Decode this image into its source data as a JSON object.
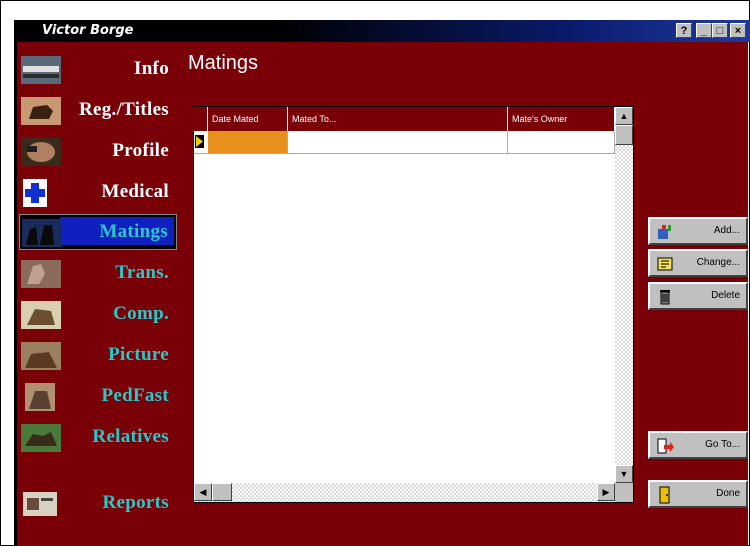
{
  "window": {
    "title": "Victor Borge"
  },
  "titlebar_buttons": {
    "help": "?",
    "minimize": "_",
    "maximize": "□",
    "close": "×"
  },
  "nav": [
    {
      "label": "Info",
      "icon": "info-icon",
      "color": "white"
    },
    {
      "label": "Reg./Titles",
      "icon": "horse-titles-icon",
      "color": "white"
    },
    {
      "label": "Profile",
      "icon": "profile-icon",
      "color": "white"
    },
    {
      "label": "Medical",
      "icon": "medical-cross-icon",
      "color": "white"
    },
    {
      "label": "Matings",
      "icon": "matings-icon",
      "color": "cyan",
      "active": true
    },
    {
      "label": "Trans.",
      "icon": "transfer-icon",
      "color": "cyan"
    },
    {
      "label": "Comp.",
      "icon": "competition-icon",
      "color": "cyan"
    },
    {
      "label": "Picture",
      "icon": "picture-icon",
      "color": "cyan"
    },
    {
      "label": "PedFast",
      "icon": "pedigree-icon",
      "color": "cyan"
    },
    {
      "label": "Relatives",
      "icon": "relatives-icon",
      "color": "cyan"
    },
    {
      "label": "Reports",
      "icon": "reports-icon",
      "color": "cyan"
    }
  ],
  "main": {
    "title": "Matings",
    "columns": [
      "Date Mated",
      "Mated To...",
      "Mate's Owner"
    ]
  },
  "actions": {
    "add": "Add...",
    "change": "Change...",
    "delete": "Delete",
    "goto": "Go To...",
    "done": "Done"
  },
  "colors": {
    "background": "#7a0008",
    "active_nav": "#1020c0",
    "selected_cell": "#e8901c",
    "nav_cyan": "#28c8c8"
  }
}
